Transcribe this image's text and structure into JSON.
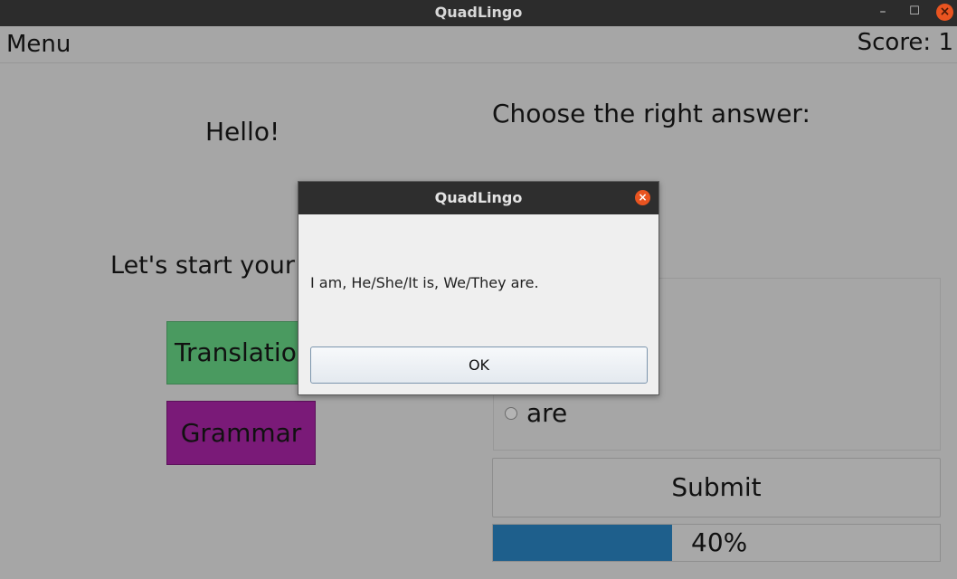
{
  "window": {
    "title": "QuadLingo",
    "minimize_glyph": "–",
    "maximize_glyph": "☐",
    "close_glyph": "×"
  },
  "menubar": {
    "menu_label": "Menu",
    "score_label": "Score: 1"
  },
  "left_panel": {
    "greeting": "Hello!",
    "start_text": "Let's start your l",
    "buttons": [
      {
        "label": "Translation",
        "color": "#4a9a60"
      },
      {
        "label": "Grammar",
        "color": "#7a1a78"
      }
    ]
  },
  "right_panel": {
    "prompt": "Choose the right answer:",
    "options": [
      {
        "label": "are",
        "selected": false
      }
    ],
    "submit_label": "Submit",
    "progress": {
      "value": 40,
      "text": "40%",
      "fill_color": "#1e5f8c"
    }
  },
  "dialog": {
    "title": "QuadLingo",
    "message": "I am, He/She/It is, We/They are.",
    "ok_label": "OK",
    "close_glyph": "×"
  },
  "colors": {
    "accent": "#e95420",
    "titlebar": "#2c2c2c"
  }
}
